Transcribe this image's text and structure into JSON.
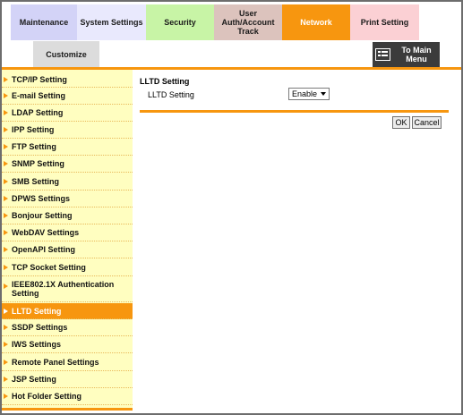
{
  "tabs": {
    "maintenance": "Maintenance",
    "system_settings": "System Settings",
    "security": "Security",
    "user_auth": "User\nAuth/Account\nTrack",
    "network": "Network",
    "print_setting": "Print Setting",
    "customize": "Customize"
  },
  "main_menu_button": "To Main Menu",
  "sidebar": {
    "items": [
      {
        "label": "TCP/IP Setting"
      },
      {
        "label": "E-mail Setting"
      },
      {
        "label": "LDAP Setting"
      },
      {
        "label": "IPP Setting"
      },
      {
        "label": "FTP Setting"
      },
      {
        "label": "SNMP Setting"
      },
      {
        "label": "SMB Setting"
      },
      {
        "label": "DPWS Settings"
      },
      {
        "label": "Bonjour Setting"
      },
      {
        "label": "WebDAV Settings"
      },
      {
        "label": "OpenAPI Setting"
      },
      {
        "label": "TCP Socket Setting"
      },
      {
        "label": "IEEE802.1X Authentication Setting"
      },
      {
        "label": "LLTD Setting"
      },
      {
        "label": "SSDP Settings"
      },
      {
        "label": "IWS Settings"
      },
      {
        "label": "Remote Panel Settings"
      },
      {
        "label": "JSP Setting"
      },
      {
        "label": "Hot Folder Setting"
      }
    ],
    "active_label": "LLTD Setting"
  },
  "content": {
    "title": "LLTD Setting",
    "field_label": "LLTD Setting",
    "field_value": "Enable",
    "ok_label": "OK",
    "cancel_label": "Cancel"
  },
  "colors": {
    "accent": "#f7960f",
    "sidebar_bg": "#fffec0"
  }
}
